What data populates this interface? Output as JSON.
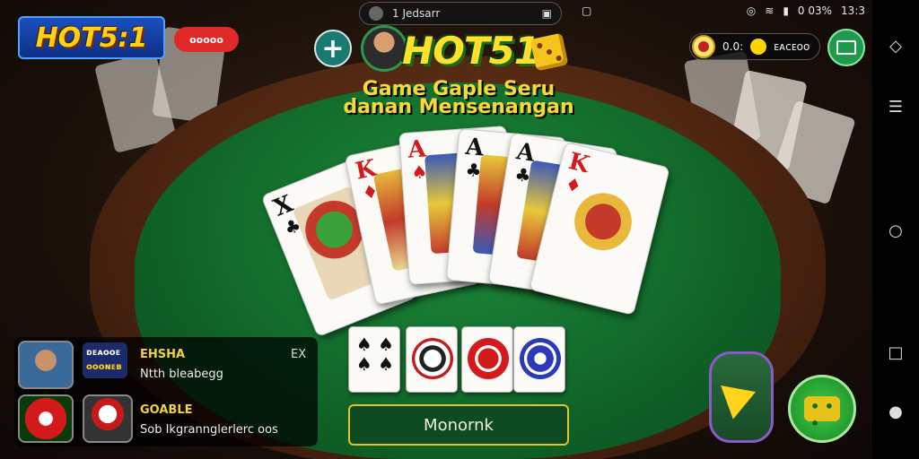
{
  "status_bar": {
    "notification_label": "1 Jedsarr",
    "battery_text": "0 03%",
    "clock": "13:3"
  },
  "header": {
    "brand_logo": "HOT5:1",
    "red_badge": "ᴏᴏᴏᴏᴏ",
    "game_title": "HOT51",
    "subtitle_line1": "Game Gaple Seru",
    "subtitle_line2": "danan Mensenangan",
    "coin_left": "0.0:",
    "coin_right": "ᴇᴀᴄᴇᴏᴏ"
  },
  "cards": [
    {
      "rank": "X",
      "suit": "♣",
      "color": "black"
    },
    {
      "rank": "K",
      "suit": "♦",
      "color": "red"
    },
    {
      "rank": "A",
      "suit": "♠",
      "color": "red"
    },
    {
      "rank": "A",
      "suit": "♣",
      "color": "black"
    },
    {
      "rank": "A",
      "suit": "♣",
      "color": "black"
    },
    {
      "rank": "K",
      "suit": "♦",
      "color": "red"
    }
  ],
  "mini_cards": [
    "♠ ♠ ♠",
    "chip-white",
    "chip-red",
    "chip-blue"
  ],
  "action_button": "Monornk",
  "players": [
    {
      "tag": "ᴅᴇᴀᴏᴏᴇ",
      "tag2": "ᴏᴏᴏɴᴇʙ",
      "name": "EHSHA",
      "sub": "Ntth bleabegg",
      "mark": "EX"
    },
    {
      "name": "GOABLE",
      "sub": "Sob Ikgrannglerlerc oos"
    }
  ],
  "nav_bar_icons": [
    "rotate-icon",
    "menu-icon",
    "home-circle-icon",
    "square-icon",
    "mic-icon"
  ]
}
